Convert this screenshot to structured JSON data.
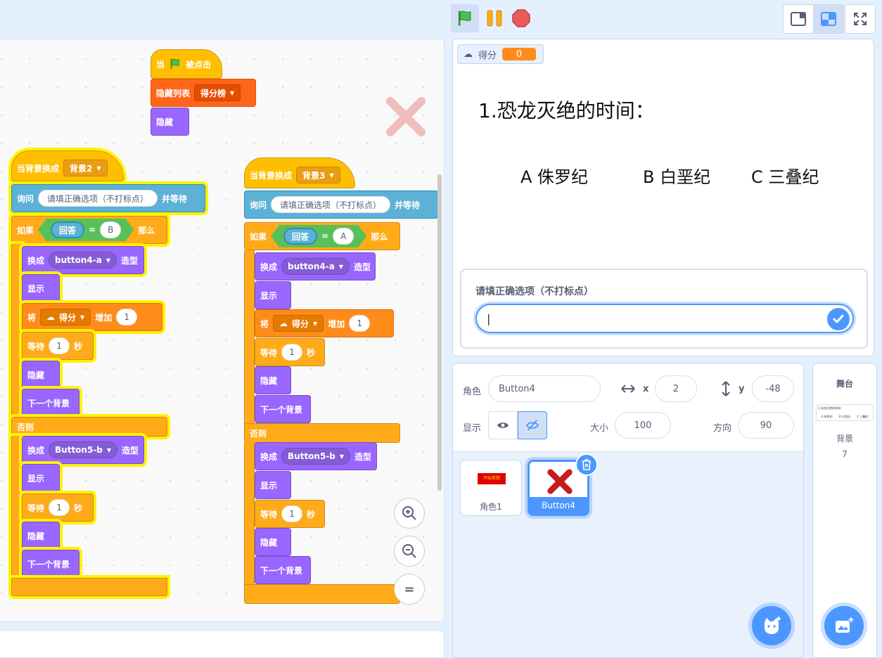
{
  "scripts": {
    "flag_script": {
      "when": "当",
      "clicked": "被点击",
      "hide_list": "隐藏列表",
      "list_name": "得分榜",
      "hide": "隐藏"
    },
    "script_left": {
      "when_backdrop": "当背景换成",
      "backdrop": "背景2",
      "ask": "询问",
      "question": "请填正确选项（不打标点）",
      "and_wait": "并等待",
      "if": "如果",
      "answer": "回答",
      "equals": "=",
      "compare": "B",
      "then": "那么",
      "switch_to": "换成",
      "costume_a": "button4-a",
      "costume_suffix": "造型",
      "show": "显示",
      "change": "将",
      "var_name": "得分",
      "by": "增加",
      "change_value": "1",
      "wait": "等待",
      "wait_value": "1",
      "seconds": "秒",
      "hide": "隐藏",
      "next_backdrop": "下一个背景",
      "else": "否则",
      "costume_b": "Button5-b"
    },
    "script_right": {
      "when_backdrop": "当背景换成",
      "backdrop": "背景3",
      "ask": "询问",
      "question": "请填正确选项（不打标点）",
      "and_wait": "并等待",
      "if": "如果",
      "answer": "回答",
      "equals": "=",
      "compare": "A",
      "then": "那么",
      "switch_to": "换成",
      "costume_a": "button4-a",
      "costume_suffix": "造型",
      "show": "显示",
      "change": "将",
      "var_name": "得分",
      "by": "增加",
      "change_value": "1",
      "wait": "等待",
      "wait_value": "1",
      "seconds": "秒",
      "hide": "隐藏",
      "next_backdrop": "下一个背景",
      "else": "否则",
      "costume_b": "Button5-b"
    }
  },
  "zoom": {
    "reset_label": "="
  },
  "stage": {
    "variable_label": "得分",
    "variable_value": "0",
    "question_text": "1.恐龙灭绝的时间：",
    "options": [
      "A 侏罗纪",
      "B 白垩纪",
      "C 三叠纪"
    ],
    "ask_prompt": "请填正确选项（不打标点）",
    "ask_value": "|"
  },
  "sprite_info": {
    "sprite_label": "角色",
    "sprite_name": "Button4",
    "x_label": "x",
    "x_value": "2",
    "y_label": "y",
    "y_value": "-48",
    "show_label": "显示",
    "size_label": "大小",
    "size_value": "100",
    "direction_label": "方向",
    "direction_value": "90"
  },
  "sprites": [
    {
      "name": "角色1",
      "thumb_text": "开始答题"
    },
    {
      "name": "Button4"
    }
  ],
  "stage_selector": {
    "title": "舞台",
    "thumb_text": "1.恐龙灭绝的时间：",
    "thumb_options": [
      "A 侏罗纪",
      "B 白垩纪",
      "C 三叠纪"
    ],
    "backdrops_label": "背景",
    "backdrops_count": "7"
  },
  "colors": {
    "events": "#ffbf00",
    "control": "#ffab19",
    "looks": "#9966ff",
    "sensing": "#5cb1d6",
    "variables": "#ff8c1a",
    "operators": "#59c059",
    "accent": "#4c97ff"
  }
}
